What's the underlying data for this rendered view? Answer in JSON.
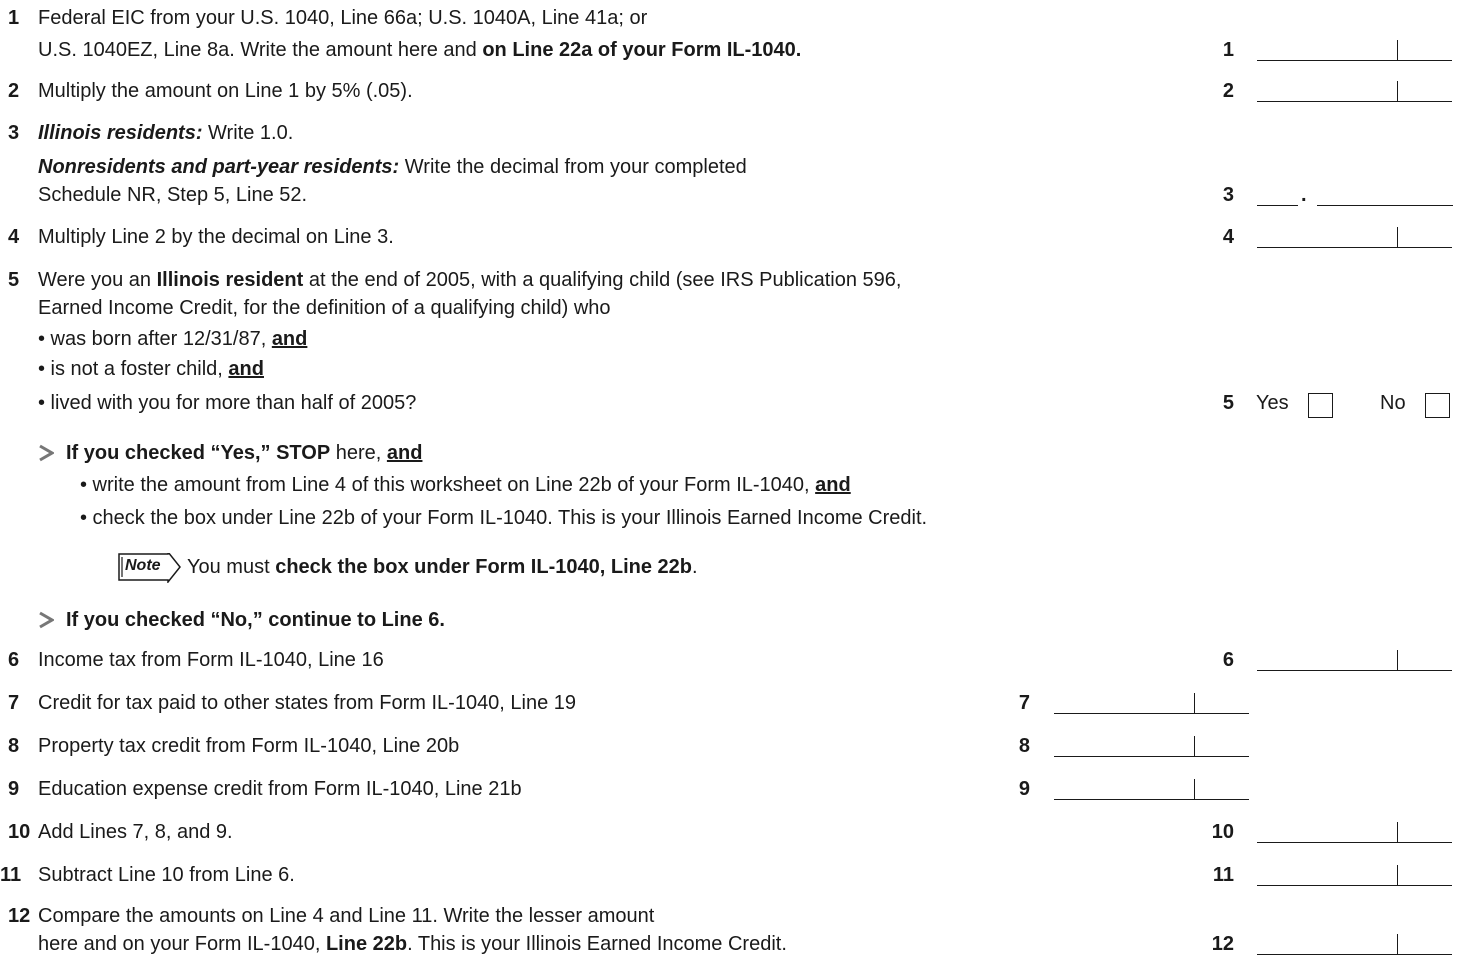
{
  "lines": {
    "l1": {
      "num": "1",
      "text_a": "Federal EIC from your U.S. 1040, Line 66a; U.S. 1040A, Line 41a; or",
      "text_b": "U.S. 1040EZ, Line 8a. Write the amount here and ",
      "text_b_bold": "on Line 22a of your Form IL-1040.",
      "ref": "1"
    },
    "l2": {
      "num": "2",
      "text": "Multiply the amount on Line 1 by 5% (.05).",
      "ref": "2"
    },
    "l3": {
      "num": "3",
      "res_label": "Illinois residents:",
      "res_text": " Write 1.0.",
      "nonres_label": "Nonresidents and part-year residents:",
      "nonres_text": " Write the decimal from your completed",
      "text_c": "Schedule NR, Step 5, Line 52.",
      "ref": "3",
      "point": "."
    },
    "l4": {
      "num": "4",
      "text": "Multiply Line 2 by the decimal on Line 3.",
      "ref": "4"
    },
    "l5": {
      "num": "5",
      "q_a_pre": "Were you an ",
      "q_a_bold": "Illinois resident",
      "q_a_post": " at the end of 2005, with a qualifying child (see IRS Publication 596,",
      "q_b": "Earned Income Credit, for the definition of a qualifying child) who",
      "bullet_1": "• was born after 12/31/87, ",
      "bullet_2": "• is not a foster child, ",
      "bullet_3": "• lived with you for more than half of 2005?",
      "and": "and",
      "ref": "5",
      "yes_label": "Yes",
      "no_label": "No"
    },
    "stop_yes": {
      "pre_bold": "If you checked “Yes,” STOP",
      "mid": " here, ",
      "and": "and",
      "sub_1": "• write the amount from Line 4 of this worksheet on Line 22b of your Form IL-1040, ",
      "sub_2": "• check the box under Line 22b of your Form IL-1040.  This is your Illinois Earned Income Credit.",
      "note_icon_text": "Note",
      "note_pre": "You must ",
      "note_bold": "check the box under Form IL-1040, Line 22b",
      "note_post": "."
    },
    "stop_no": {
      "text": "If you checked “No,” continue to Line 6."
    },
    "l6": {
      "num": "6",
      "text": "Income tax from Form IL-1040, Line 16",
      "ref": "6"
    },
    "l7": {
      "num": "7",
      "text": "Credit for tax paid to other states from Form IL-1040, Line 19",
      "ref": "7"
    },
    "l8": {
      "num": "8",
      "text": "Property tax credit from Form IL-1040, Line 20b",
      "ref": "8"
    },
    "l9": {
      "num": "9",
      "text": "Education expense credit from Form IL-1040, Line 21b",
      "ref": "9"
    },
    "l10": {
      "num": "10",
      "text": "Add Lines 7, 8, and 9.",
      "ref": "10"
    },
    "l11": {
      "num": "11",
      "text": "Subtract Line 10 from Line 6.",
      "ref": "11"
    },
    "l12": {
      "num": "12",
      "text_a": "Compare the amounts on Line 4 and Line 11. Write the lesser amount",
      "text_b": "here and on your Form IL-1040, ",
      "text_b_bold": "Line 22b",
      "text_b_post": ". This is your Illinois Earned Income Credit.",
      "ref": "12"
    }
  }
}
